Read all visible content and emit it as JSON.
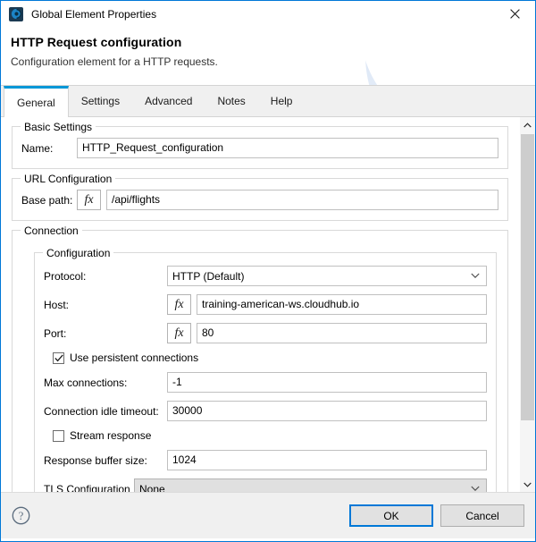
{
  "window": {
    "title": "Global Element Properties",
    "app_icon": "mule-icon",
    "close_icon": "close-icon"
  },
  "header": {
    "title": "HTTP Request configuration",
    "subtitle": "Configuration element for a HTTP requests."
  },
  "tabs": [
    {
      "label": "General",
      "active": true
    },
    {
      "label": "Settings",
      "active": false
    },
    {
      "label": "Advanced",
      "active": false
    },
    {
      "label": "Notes",
      "active": false
    },
    {
      "label": "Help",
      "active": false
    }
  ],
  "basic_settings": {
    "legend": "Basic Settings",
    "name_label": "Name:",
    "name_value": "HTTP_Request_configuration"
  },
  "url_configuration": {
    "legend": "URL Configuration",
    "base_path_label": "Base path:",
    "base_path_fx": "fx",
    "base_path_value": "/api/flights"
  },
  "connection": {
    "legend": "Connection",
    "configuration": {
      "legend": "Configuration",
      "protocol_label": "Protocol:",
      "protocol_value": "HTTP (Default)",
      "host_label": "Host:",
      "host_fx": "fx",
      "host_value": "training-american-ws.cloudhub.io",
      "port_label": "Port:",
      "port_fx": "fx",
      "port_value": "80",
      "persistent_label": "Use persistent connections",
      "persistent_checked": true,
      "max_connections_label": "Max connections:",
      "max_connections_value": "-1",
      "idle_timeout_label": "Connection idle timeout:",
      "idle_timeout_value": "30000",
      "stream_response_label": "Stream response",
      "stream_response_checked": false,
      "buffer_size_label": "Response buffer size:",
      "buffer_size_value": "1024",
      "tls_label": "TLS Configuration",
      "tls_value": "None"
    }
  },
  "scrollbar": {
    "up_icon": "chevron-up-icon",
    "down_icon": "chevron-down-icon"
  },
  "footer": {
    "help_icon": "help-circle-icon",
    "ok_label": "OK",
    "cancel_label": "Cancel"
  },
  "colors": {
    "accent": "#0078d7",
    "tab_active_border": "#0097d7",
    "titlebar_bg": "#ffffff",
    "footer_bg": "#f0f0f0",
    "scroll_thumb": "#cdcdcd"
  }
}
